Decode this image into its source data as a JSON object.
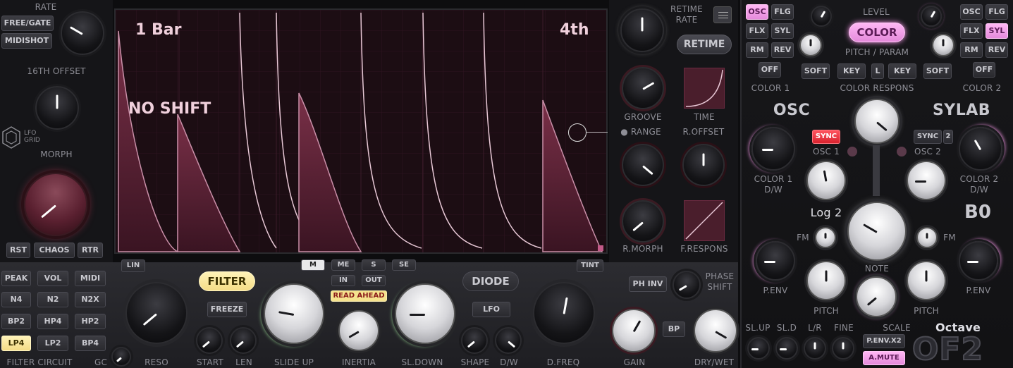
{
  "left": {
    "rate_label": "RATE",
    "free_gate": "FREE/GATE",
    "midishot": "MIDISHOT",
    "offset_label": "16TH OFFSET",
    "logo_line1": "LFO",
    "logo_line2": "GRID",
    "morph_label": "MORPH",
    "rst": "RST",
    "chaos": "CHAOS",
    "rtr": "RTR"
  },
  "display": {
    "bars": "1 Bar",
    "division": "4th",
    "shift": "NO SHIFT"
  },
  "right_lfo": {
    "retime_rate_line1": "RETIME",
    "retime_rate_line2": "RATE",
    "retime_button": "RETIME",
    "groove": "GROOVE",
    "time": "TIME",
    "range": "RANGE",
    "roffset": "R.OFFSET",
    "rmorph": "R.MORPH",
    "fresponse": "F.RESPONS"
  },
  "filter_circuit": {
    "types": [
      "PEAK",
      "VOL",
      "MIDI",
      "N4",
      "N2",
      "N2X",
      "BP2",
      "HP4",
      "HP2",
      "LP4",
      "LP2",
      "BP4"
    ],
    "selected": "LP4",
    "label": "FILTER CIRCUIT",
    "gc": "GC"
  },
  "filter": {
    "lin": "LIN",
    "reso": "RESO",
    "filter_button": "FILTER",
    "freeze": "FREEZE",
    "start": "START",
    "len": "LEN",
    "slide_up": "SLIDE UP",
    "modes": [
      "M",
      "ME",
      "S",
      "SE"
    ],
    "in": "IN",
    "out": "OUT",
    "read_ahead": "READ AHEAD",
    "inertia": "INERTIA",
    "sl_down": "SL.DOWN",
    "diode": "DIODE",
    "lfo": "LFO",
    "shape": "SHAPE",
    "dw": "D/W",
    "tint": "TINT",
    "dfreq": "D.FREQ",
    "ph_inv": "PH INV",
    "phase_shift_1": "PHASE",
    "phase_shift_2": "SHIFT",
    "bp": "BP",
    "gain": "GAIN",
    "dry_wet": "DRY/WET"
  },
  "color": {
    "left_buttons": [
      "OSC",
      "FLG",
      "FLX",
      "SYL",
      "RM",
      "REV",
      "OFF"
    ],
    "right_buttons": [
      "OSC",
      "FLG",
      "FLX",
      "SYL",
      "RM",
      "REV",
      "OFF"
    ],
    "left_selected": "OSC",
    "right_selected": "SYL",
    "level": "LEVEL",
    "color_button": "COLOR",
    "pitch_param": "PITCH / PARAM",
    "soft_l": "SOFT",
    "key_l": "KEY",
    "l": "L",
    "key_r": "KEY",
    "soft_r": "SOFT",
    "color1": "COLOR 1",
    "color_respons": "COLOR RESPONS",
    "color2": "COLOR 2",
    "osc_title": "OSC",
    "sylab_title": "SYLAB",
    "sync1": "SYNC",
    "sync2": "SYNC",
    "two": "2",
    "osc1": "OSC 1",
    "osc2": "OSC 2",
    "color1_dw_1": "COLOR 1",
    "color1_dw_2": "D/W",
    "color2_dw_1": "COLOR 2",
    "color2_dw_2": "D/W",
    "log2": "Log 2",
    "b0": "B0",
    "fm_l": "FM",
    "fm_r": "FM",
    "penv_l": "P.ENV",
    "penv_r": "P.ENV",
    "note": "NOTE",
    "pitch_l": "PITCH",
    "pitch_r": "PITCH",
    "sl_up": "SL.UP",
    "sl_d": "SL.D",
    "lr": "L/R",
    "fine": "FINE",
    "scale": "SCALE",
    "octave": "Octave",
    "penv_x2": "P.ENV.X2",
    "a_mute": "A.MUTE",
    "logo": "OF2"
  },
  "colors": {
    "accent_pink": "#ff9ef0",
    "wave": "#6a2a40",
    "sync_red": "#e8303c"
  }
}
